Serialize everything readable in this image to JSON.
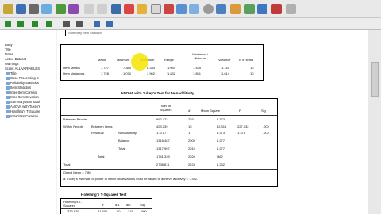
{
  "left_panel": {
    "items": [
      "Body",
      "Title",
      "Notes",
      "Active Dataset",
      "Warnings",
      "Scale: ALL VARIABLES",
      "Title",
      "Case Processing S",
      "Reliability Statistics",
      "Item Statistics",
      "Inter-Item Correlat",
      "Inter-Item Covarian",
      "Summary Item Stati",
      "ANOVA with Tukey's",
      "Hotelling's T-Square",
      "Intraclass Correlati"
    ]
  },
  "header_snippet": "Summary Item Statistics",
  "summary_table": {
    "title": "Summary Item Statistics",
    "headers": [
      "Mean",
      "Minimum",
      "Maximum",
      "Range",
      "Maximum / Minimum",
      "Variance",
      "N of Items"
    ],
    "rows": [
      {
        "label": "Item Means",
        "values": [
          "7.727",
          "7.380",
          "8.334",
          "1.054",
          "1.449",
          "1.116",
          "10"
        ]
      },
      {
        "label": "Item Variances",
        "values": [
          "1.728",
          "1.070",
          "1.902",
          "1.832",
          "1.851",
          "1.614",
          "10"
        ]
      }
    ]
  },
  "anova_table": {
    "title": "ANOVA with Tukey's Test for Nonadditivity",
    "headers": [
      "Sum of Squares",
      "df",
      "Mean Square",
      "F",
      "Sig"
    ],
    "rows": [
      {
        "c1": "Between People",
        "c2": "",
        "c3": "",
        "values": [
          "997.472",
          "203",
          "5.373",
          "",
          ""
        ]
      },
      {
        "c1": "Within People",
        "c2": "Between Items",
        "c3": "",
        "values": [
          "423.139",
          "10",
          "42.314",
          "227.632",
          ".000"
        ]
      },
      {
        "c1": "",
        "c2": "Residual",
        "c3": "Nonadditivity",
        "values": [
          "1.3717",
          "1",
          "1.373",
          "1.373",
          ".000"
        ]
      },
      {
        "c1": "",
        "c2": "",
        "c3": "Balance",
        "values": [
          "1316.487",
          "2009",
          "1.277",
          "",
          ""
        ]
      },
      {
        "c1": "",
        "c2": "",
        "c3": "Total",
        "values": [
          "1317.907",
          "2010",
          "1.277",
          "",
          ""
        ]
      },
      {
        "c1": "",
        "c2": "Total",
        "c3": "",
        "values": [
          "1741.339",
          "2020",
          ".862",
          "",
          ""
        ]
      },
      {
        "c1": "Total",
        "c2": "",
        "c3": "",
        "values": [
          "2738.811",
          "2223",
          "1.232",
          "",
          ""
        ]
      }
    ],
    "grand_mean": "Grand Mean = 7.80",
    "footnote": "a. Tukey's estimate of power to which observations must be raised to achieve additivity = 1.362."
  },
  "hotelling_table": {
    "title": "Hotelling's T-Squared Test",
    "headers": [
      "Hotelling's T-Squared",
      "F",
      "df1",
      "df2",
      "Sig"
    ],
    "row": [
      "323.679",
      "31.600",
      "10",
      "215",
      ".000"
    ]
  },
  "colors": {
    "cursor": "#f5e400",
    "title_bar": "#e9e9e9"
  }
}
